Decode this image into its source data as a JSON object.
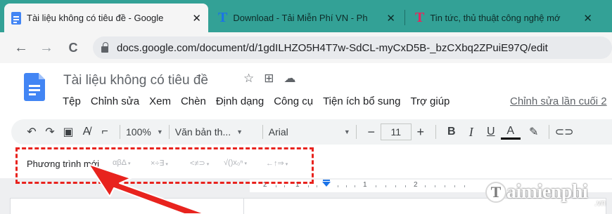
{
  "browser": {
    "tabs": [
      {
        "title": "Tài liệu không có tiêu đề - Google",
        "favicon": "google-docs-icon",
        "active": true
      },
      {
        "title": "Download - Tải Miễn Phí VN - Ph",
        "favicon": "taimienphi-t-icon",
        "active": false
      },
      {
        "title": "Tin tức, thủ thuật công nghệ mớ",
        "favicon": "taimienphi-red-t-icon",
        "active": false
      }
    ],
    "close_glyph": "✕",
    "new_tab_glyph": "+",
    "url": "docs.google.com/document/d/1gdILHZO5H4T7w-SdCL-myCxD5B-_bzCXbq2ZPuiE97Q/edit",
    "nav": {
      "back": "←",
      "forward": "→",
      "reload": "C"
    }
  },
  "docs": {
    "title": "Tài liệu không có tiêu đề",
    "title_icons": {
      "star": "☆",
      "move": "⊞",
      "cloud": "☁"
    },
    "menu": [
      "Tệp",
      "Chỉnh sửa",
      "Xem",
      "Chèn",
      "Định dạng",
      "Công cụ",
      "Tiện ích bổ sung",
      "Trợ giúp"
    ],
    "last_edit": "Chỉnh sửa lần cuối 2"
  },
  "toolbar": {
    "undo": "↶",
    "redo": "↷",
    "print": "▣",
    "spell": "A̸",
    "paint": "⌐",
    "zoom": "100%",
    "style": "Văn bản th...",
    "font": "Arial",
    "minus": "−",
    "font_size": "11",
    "plus": "+",
    "bold": "B",
    "italic": "I",
    "underline": "U",
    "text_color": "A",
    "highlight": "✎",
    "link": "⊂⊃"
  },
  "equation_toolbar": {
    "new_equation": "Phương trình mới",
    "groups": [
      "αβΔ",
      "×÷∃",
      "<≠⊃",
      "√()x₀ⁿ",
      "←↑⇒"
    ],
    "caret": "▾"
  },
  "ruler": {
    "numbers": [
      "2",
      "1",
      "1",
      "2"
    ]
  },
  "watermark": {
    "brand": "aimienphi",
    "initial": "T",
    "tld": ".vn"
  },
  "colors": {
    "tab_strip": "#33a196",
    "highlight_border": "#e8231e",
    "arrow": "#e8231e",
    "docs_blue": "#4285f4"
  }
}
